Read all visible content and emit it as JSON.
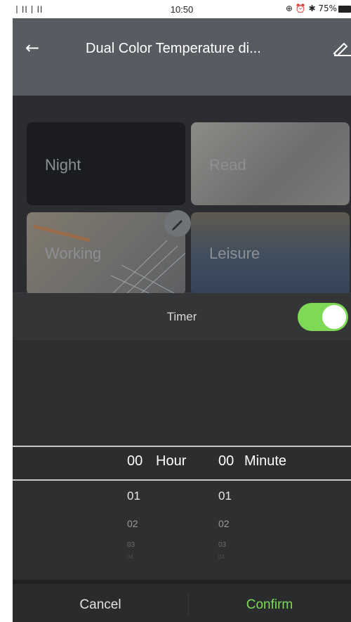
{
  "status_bar": {
    "signal": "丨ll丨ll",
    "time": "10:50",
    "icons_right": "⊕ ⏰ ✱ 75%",
    "battery_percent": "75%"
  },
  "header": {
    "title": "Dual Color Temperature di..."
  },
  "scenes": [
    {
      "label": "Night"
    },
    {
      "label": "Read"
    },
    {
      "label": "Working"
    },
    {
      "label": "Leisure"
    }
  ],
  "timer": {
    "label": "Timer",
    "enabled": true
  },
  "picker": {
    "hour_unit": "Hour",
    "minute_unit": "Minute",
    "hours": [
      "00",
      "01",
      "02",
      "03",
      "04"
    ],
    "minutes": [
      "00",
      "01",
      "02",
      "03",
      "04"
    ]
  },
  "footer": {
    "cancel_label": "Cancel",
    "confirm_label": "Confirm"
  },
  "colors": {
    "accent": "#7ed957",
    "sheet_bg": "#2e2f31"
  }
}
